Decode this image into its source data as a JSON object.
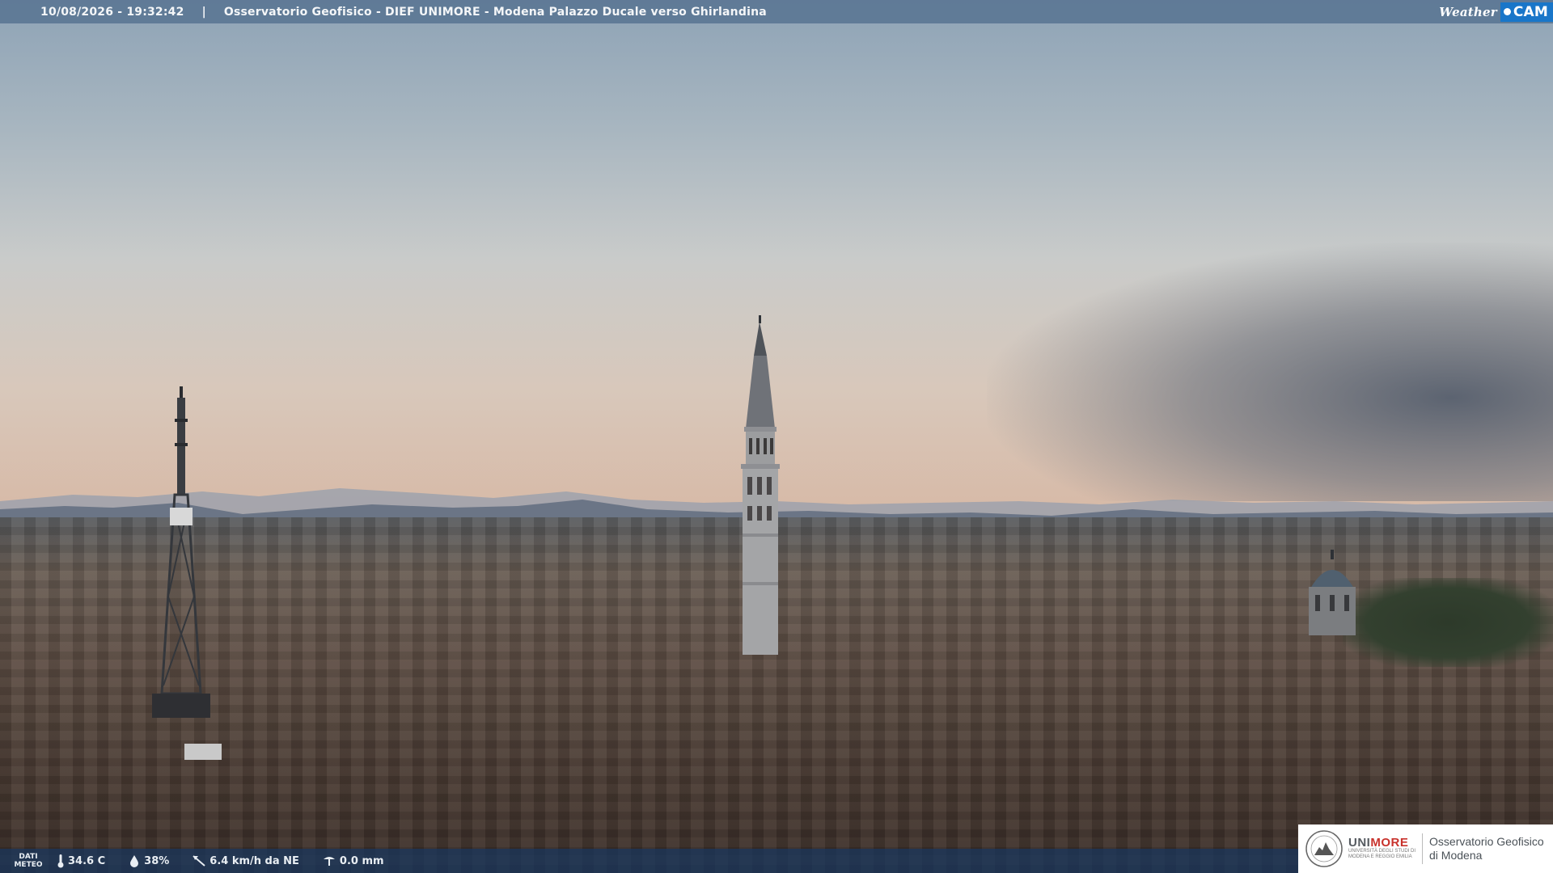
{
  "header": {
    "timestamp": "10/08/2026 - 19:32:42",
    "separator": "|",
    "caption": "Osservatorio Geofisico - DIEF UNIMORE - Modena Palazzo Ducale verso Ghirlandina",
    "brand_weather": "Weather",
    "brand_cam": "CAM"
  },
  "meteo": {
    "label_line1": "DATI",
    "label_line2": "METEO",
    "temperature": "34.6 C",
    "humidity": "38%",
    "wind": "6.4 km/h da NE",
    "rain": "0.0 mm"
  },
  "logo": {
    "uni": "UNI",
    "more": "MORE",
    "uni_subtitle_1": "UNIVERSITÀ DEGLI STUDI DI",
    "uni_subtitle_2": "MODENA E REGGIO EMILIA",
    "observatory_line1": "Osservatorio Geofisico",
    "observatory_line2": "di Modena"
  },
  "colors": {
    "top_bar": "#56718f",
    "bottom_bar": "#19375f",
    "brand_blue": "#1976c9",
    "unimore_red": "#c8322c"
  }
}
